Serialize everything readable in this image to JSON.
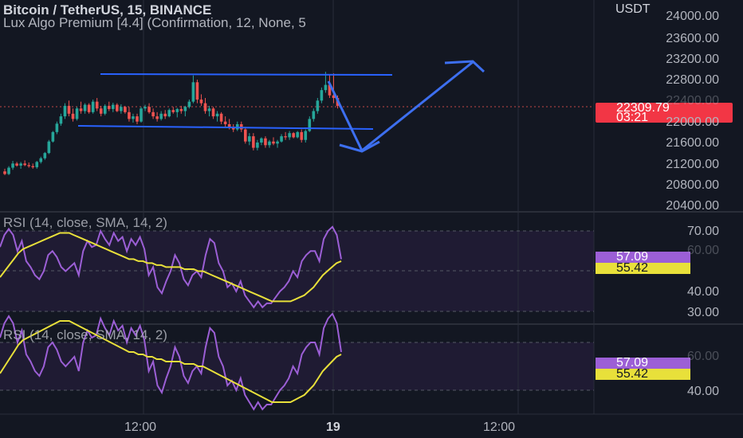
{
  "header": {
    "symbol_line": "Bitcoin / TetherUS, 15, BINANCE",
    "indicator_line": "Lux Algo Premium [4.4] (Confirmation, 12, None, 5"
  },
  "price_axis": {
    "currency": "USDT",
    "ticks": [
      "24000.00",
      "23600.00",
      "23200.00",
      "22800.00",
      "22400.00",
      "22000.00",
      "21600.00",
      "21200.00",
      "20800.00",
      "20400.00"
    ]
  },
  "last_price": {
    "value": "22309.79",
    "countdown": "03:21",
    "color": "#f23645"
  },
  "rsi_panel_1": {
    "title": "RSI (14, close, SMA, 14, 2)",
    "ticks": [
      "70.00",
      "60.00",
      "40.00",
      "30.00"
    ],
    "rsi_value": "57.09",
    "sma_value": "55.42"
  },
  "rsi_panel_2": {
    "title": "RSI (14, close, SMA, 14, 2)",
    "ticks": [
      "60.00",
      "40.00"
    ],
    "rsi_value": "57.09",
    "sma_value": "55.42"
  },
  "time_axis": {
    "labels": [
      "12:00",
      "19",
      "12:00"
    ]
  },
  "colors": {
    "background": "#131722",
    "up": "#26a69a",
    "down": "#ef5350",
    "drawing": "#2962ff",
    "rsi": "#9c5fd6",
    "sma": "#e8e03a"
  },
  "chart_data": {
    "type": "candlestick",
    "y_min": 20400,
    "y_max": 24000,
    "candles": [
      [
        21050,
        21100,
        20980,
        21000
      ],
      [
        21000,
        21150,
        20980,
        21120
      ],
      [
        21120,
        21250,
        21080,
        21200
      ],
      [
        21200,
        21230,
        21140,
        21160
      ],
      [
        21160,
        21230,
        21100,
        21200
      ],
      [
        21200,
        21260,
        21150,
        21170
      ],
      [
        21170,
        21220,
        21120,
        21150
      ],
      [
        21150,
        21200,
        21100,
        21130
      ],
      [
        21130,
        21250,
        21100,
        21230
      ],
      [
        21230,
        21330,
        21200,
        21300
      ],
      [
        21300,
        21420,
        21270,
        21400
      ],
      [
        21400,
        21650,
        21380,
        21620
      ],
      [
        21620,
        21820,
        21600,
        21800
      ],
      [
        21800,
        22000,
        21760,
        21960
      ],
      [
        21960,
        22150,
        21920,
        22100
      ],
      [
        22100,
        22350,
        22050,
        22300
      ],
      [
        22300,
        22400,
        22100,
        22150
      ],
      [
        22150,
        22250,
        22000,
        22050
      ],
      [
        22050,
        22280,
        22020,
        22250
      ],
      [
        22250,
        22380,
        22150,
        22200
      ],
      [
        22200,
        22350,
        22150,
        22320
      ],
      [
        22320,
        22350,
        22150,
        22180
      ],
      [
        22180,
        22420,
        22150,
        22380
      ],
      [
        22380,
        22450,
        22200,
        22250
      ],
      [
        22250,
        22300,
        22100,
        22150
      ],
      [
        22150,
        22330,
        22120,
        22300
      ],
      [
        22300,
        22380,
        22200,
        22240
      ],
      [
        22240,
        22360,
        22180,
        22320
      ],
      [
        22320,
        22350,
        22180,
        22200
      ],
      [
        22200,
        22330,
        22150,
        22280
      ],
      [
        22280,
        22300,
        22150,
        22180
      ],
      [
        22180,
        22280,
        22000,
        22050
      ],
      [
        22050,
        22150,
        21980,
        22100
      ],
      [
        22100,
        22150,
        21950,
        22000
      ],
      [
        22000,
        22280,
        21980,
        22250
      ],
      [
        22250,
        22320,
        22200,
        22280
      ],
      [
        22280,
        22350,
        22150,
        22180
      ],
      [
        22180,
        22250,
        22050,
        22100
      ],
      [
        22100,
        22180,
        22000,
        22050
      ],
      [
        22050,
        22200,
        22020,
        22150
      ],
      [
        22150,
        22220,
        22050,
        22100
      ],
      [
        22100,
        22250,
        22080,
        22220
      ],
      [
        22220,
        22280,
        22150,
        22180
      ],
      [
        22180,
        22260,
        22080,
        22240
      ],
      [
        22240,
        22300,
        22150,
        22200
      ],
      [
        22200,
        22300,
        22100,
        22280
      ],
      [
        22280,
        22420,
        22250,
        22380
      ],
      [
        22380,
        22880,
        22350,
        22750
      ],
      [
        22750,
        22800,
        22350,
        22420
      ],
      [
        22420,
        22520,
        22300,
        22350
      ],
      [
        22350,
        22450,
        22150,
        22200
      ],
      [
        22200,
        22300,
        22100,
        22250
      ],
      [
        22250,
        22280,
        22050,
        22100
      ],
      [
        22100,
        22200,
        22000,
        22150
      ],
      [
        22150,
        22180,
        21950,
        22000
      ],
      [
        22000,
        22100,
        21880,
        21950
      ],
      [
        21950,
        22050,
        21850,
        21900
      ],
      [
        21900,
        21950,
        21800,
        21850
      ],
      [
        21850,
        22000,
        21820,
        21950
      ],
      [
        21950,
        22000,
        21800,
        21850
      ],
      [
        21850,
        21900,
        21580,
        21620
      ],
      [
        21620,
        21780,
        21550,
        21720
      ],
      [
        21720,
        21780,
        21450,
        21500
      ],
      [
        21500,
        21650,
        21450,
        21600
      ],
      [
        21600,
        21700,
        21550,
        21680
      ],
      [
        21680,
        21720,
        21500,
        21550
      ],
      [
        21550,
        21650,
        21500,
        21620
      ],
      [
        21620,
        21700,
        21550,
        21580
      ],
      [
        21580,
        21650,
        21500,
        21620
      ],
      [
        21620,
        21760,
        21600,
        21720
      ],
      [
        21720,
        21800,
        21650,
        21700
      ],
      [
        21700,
        21820,
        21650,
        21780
      ],
      [
        21780,
        21800,
        21680,
        21700
      ],
      [
        21700,
        21820,
        21680,
        21800
      ],
      [
        21800,
        21850,
        21600,
        21650
      ],
      [
        21650,
        21850,
        21600,
        21820
      ],
      [
        21820,
        22100,
        21800,
        22050
      ],
      [
        22050,
        22250,
        22000,
        22200
      ],
      [
        22200,
        22450,
        22150,
        22400
      ],
      [
        22400,
        22650,
        22350,
        22600
      ],
      [
        22600,
        22950,
        22550,
        22700
      ],
      [
        22700,
        22900,
        22450,
        22500
      ],
      [
        22500,
        22920,
        22350,
        22450
      ],
      [
        22450,
        22500,
        22250,
        22300
      ]
    ],
    "rsi": [
      62,
      68,
      71,
      68,
      60,
      65,
      55,
      52,
      48,
      46,
      50,
      58,
      60,
      57,
      52,
      50,
      52,
      54,
      48,
      60,
      65,
      62,
      63,
      70,
      66,
      63,
      69,
      65,
      67,
      60,
      66,
      63,
      67,
      61,
      48,
      52,
      42,
      39,
      45,
      50,
      58,
      54,
      46,
      43,
      48,
      50,
      47,
      58,
      66,
      64,
      54,
      50,
      42,
      44,
      40,
      45,
      38,
      35,
      32,
      35,
      32,
      34,
      34,
      37,
      40,
      42,
      45,
      50,
      47,
      55,
      58,
      60,
      60,
      55,
      66,
      70,
      72,
      68,
      56
    ],
    "rsi_sma": [
      47,
      50,
      53,
      56,
      59,
      61,
      62,
      63,
      64,
      65,
      66,
      67,
      68,
      69,
      69,
      69,
      68,
      67,
      66,
      65,
      64,
      63,
      62,
      61,
      60,
      59,
      58,
      57,
      56,
      56,
      55,
      55,
      54,
      54,
      53,
      53,
      52,
      52,
      52,
      52,
      51,
      51,
      51,
      50,
      50,
      49,
      48,
      47,
      46,
      45,
      44,
      43,
      42,
      41,
      40,
      39,
      38,
      37,
      36,
      35,
      35,
      35,
      35,
      35,
      36,
      37,
      38,
      40,
      42,
      45,
      48,
      50,
      52,
      54,
      55
    ]
  }
}
